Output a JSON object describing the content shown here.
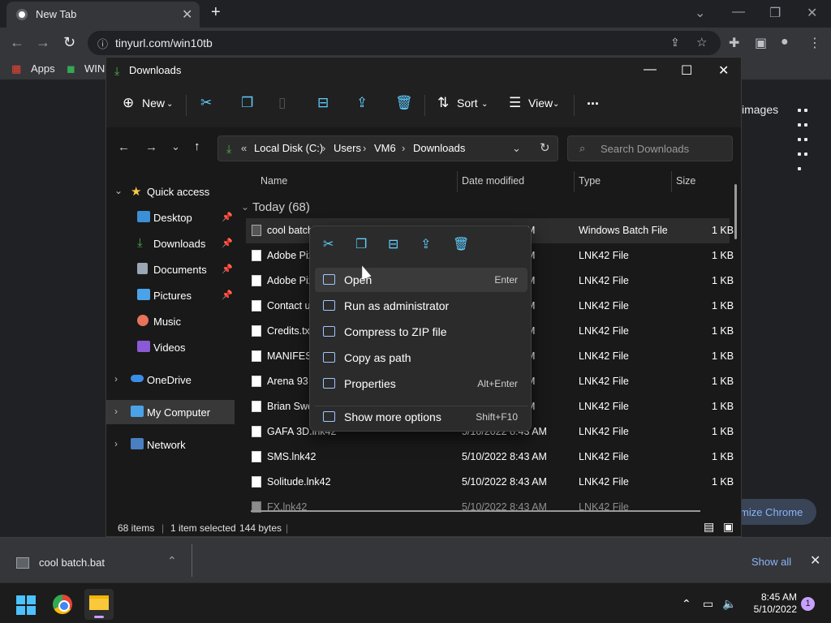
{
  "chrome": {
    "tab_title": "New Tab",
    "url": "tinyurl.com/win10tb",
    "bookmarks": {
      "apps": "Apps",
      "win": "WIN"
    },
    "images_link": "images",
    "customize": "mize Chrome"
  },
  "window": {
    "title": "Downloads",
    "toolbar": {
      "new": "New",
      "sort": "Sort",
      "view": "View",
      "more": "..."
    },
    "breadcrumb": [
      "Local Disk (C:)",
      "Users",
      "VM6",
      "Downloads"
    ],
    "search_placeholder": "Search Downloads",
    "nav": {
      "quick_access": "Quick access",
      "items": [
        "Desktop",
        "Downloads",
        "Documents",
        "Pictures",
        "Music",
        "Videos"
      ],
      "onedrive": "OneDrive",
      "my_computer": "My Computer",
      "network": "Network"
    },
    "columns": {
      "name": "Name",
      "date": "Date modified",
      "type": "Type",
      "size": "Size"
    },
    "group": "Today (68)",
    "files": [
      {
        "name": "cool batch",
        "date": "M",
        "type": "Windows Batch File",
        "size": "1 KB"
      },
      {
        "name": "Adobe Piz",
        "date": "M",
        "type": "LNK42 File",
        "size": "1 KB"
      },
      {
        "name": "Adobe Piz",
        "date": "M",
        "type": "LNK42 File",
        "size": "1 KB"
      },
      {
        "name": "Contact u",
        "date": "M",
        "type": "LNK42 File",
        "size": "1 KB"
      },
      {
        "name": "Credits.txt",
        "date": "M",
        "type": "LNK42 File",
        "size": "1 KB"
      },
      {
        "name": "MANIFEST",
        "date": "M",
        "type": "LNK42 File",
        "size": "1 KB"
      },
      {
        "name": "Arena 93 r",
        "date": "M",
        "type": "LNK42 File",
        "size": "1 KB"
      },
      {
        "name": "Brian Swe",
        "date": "M",
        "type": "LNK42 File",
        "size": "1 KB"
      },
      {
        "name": "GAFA 3D.lnk42",
        "date": "5/10/2022 8:43 AM",
        "type": "LNK42 File",
        "size": "1 KB"
      },
      {
        "name": "SMS.lnk42",
        "date": "5/10/2022 8:43 AM",
        "type": "LNK42 File",
        "size": "1 KB"
      },
      {
        "name": "Solitude.lnk42",
        "date": "5/10/2022 8:43 AM",
        "type": "LNK42 File",
        "size": "1 KB"
      },
      {
        "name": "FX.lnk42",
        "date": "5/10/2022 8:43 AM",
        "type": "LNK42 File",
        "size": ""
      }
    ],
    "status": {
      "count": "68 items",
      "selected": "1 item selected",
      "bytes": "144 bytes"
    }
  },
  "context_menu": {
    "items": [
      {
        "label": "Open",
        "key": "Enter"
      },
      {
        "label": "Run as administrator",
        "key": ""
      },
      {
        "label": "Compress to ZIP file",
        "key": ""
      },
      {
        "label": "Copy as path",
        "key": ""
      },
      {
        "label": "Properties",
        "key": "Alt+Enter"
      }
    ],
    "more": {
      "label": "Show more options",
      "key": "Shift+F10"
    }
  },
  "download_bar": {
    "file": "cool batch.bat",
    "show_all": "Show all"
  },
  "taskbar": {
    "time": "8:45 AM",
    "date": "5/10/2022",
    "notifications": "1"
  }
}
